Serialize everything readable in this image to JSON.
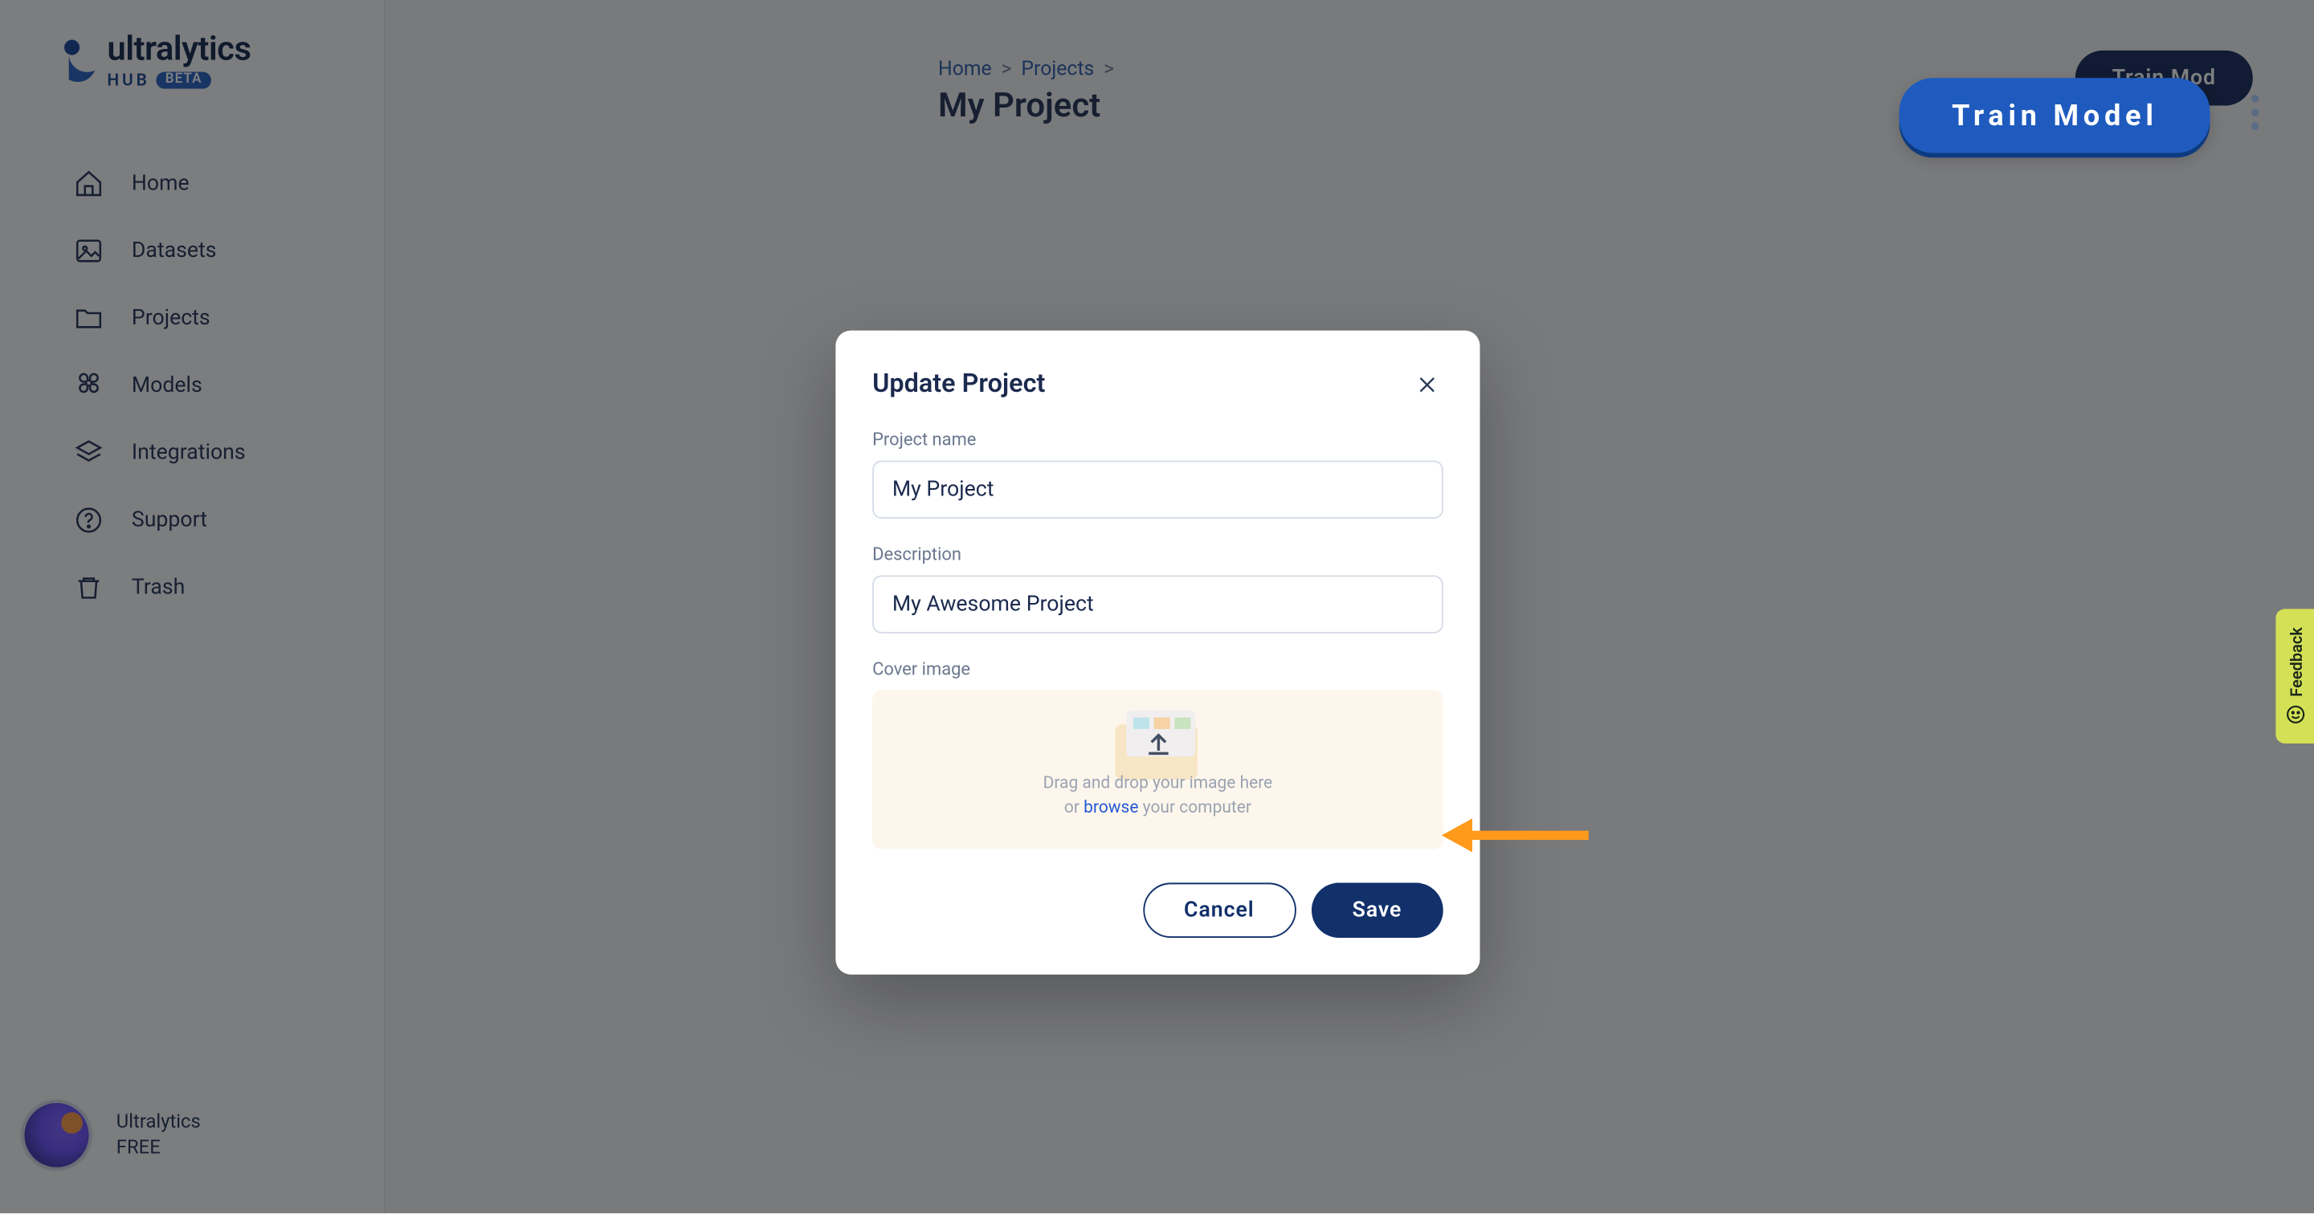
{
  "brand": {
    "name": "ultralytics",
    "hub": "HUB",
    "beta": "BETA"
  },
  "sidebar": {
    "items": [
      {
        "label": "Home"
      },
      {
        "label": "Datasets"
      },
      {
        "label": "Projects"
      },
      {
        "label": "Models"
      },
      {
        "label": "Integrations"
      },
      {
        "label": "Support"
      },
      {
        "label": "Trash"
      }
    ]
  },
  "user": {
    "name": "Ultralytics",
    "plan": "FREE"
  },
  "breadcrumb": {
    "home": "Home",
    "projects": "Projects"
  },
  "page": {
    "title": "My Project"
  },
  "header": {
    "train_pill_dark": "Train Mod",
    "train_float": "Train Model"
  },
  "feedback": {
    "label": "Feedback"
  },
  "modal": {
    "title": "Update Project",
    "project_name_label": "Project name",
    "project_name_value": "My Project",
    "description_label": "Description",
    "description_value": "My Awesome Project",
    "cover_image_label": "Cover image",
    "dropzone_line1": "Drag and drop your image here",
    "dropzone_or": "or ",
    "dropzone_browse": "browse",
    "dropzone_tail": " your computer",
    "cancel": "Cancel",
    "save": "Save"
  },
  "colors": {
    "primary": "#12316b",
    "accent": "#1f5bbf",
    "annotation": "#ff9a1a"
  }
}
